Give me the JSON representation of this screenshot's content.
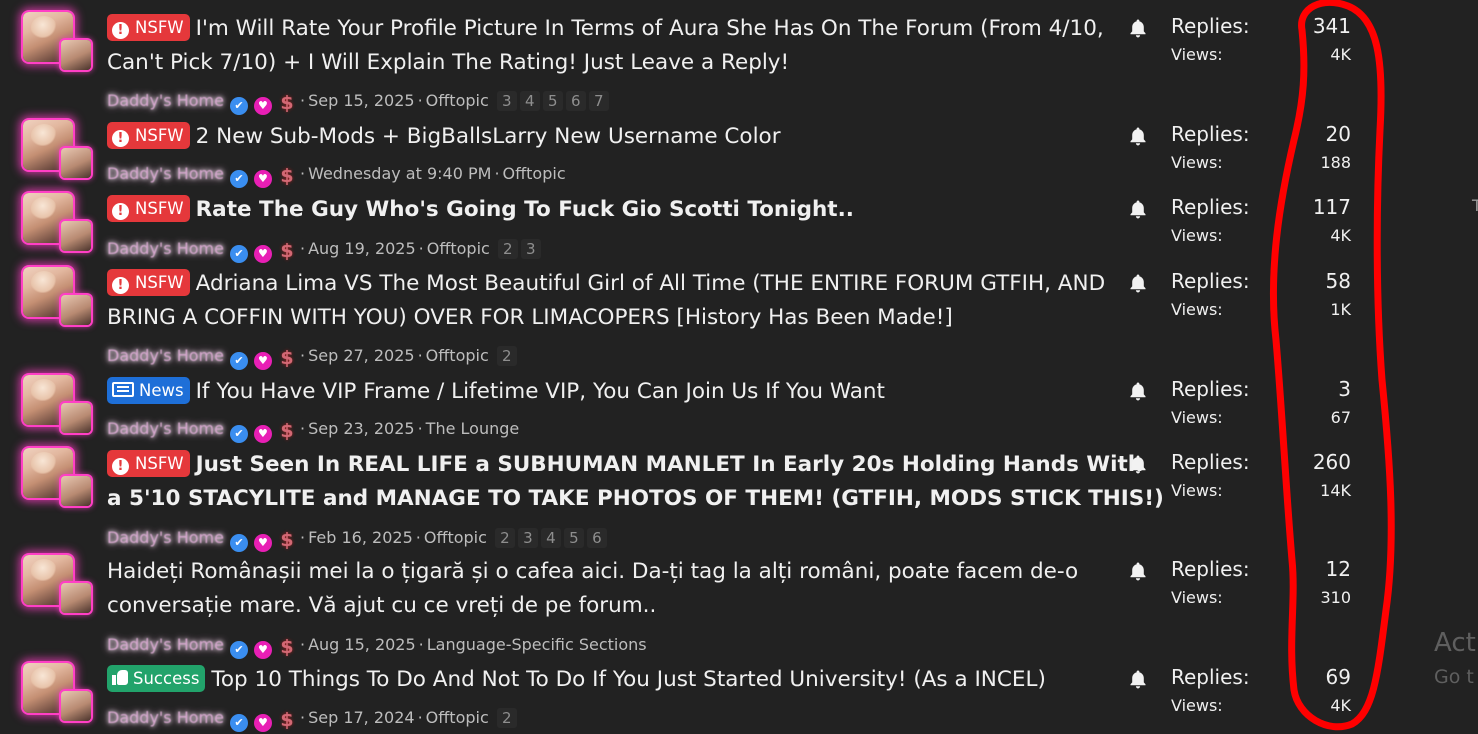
{
  "threads": [
    {
      "prefix": {
        "label": "NSFW",
        "type": "nsfw"
      },
      "title_lines": [
        "I'm Will Rate Your Profile Picture In Terms of Aura She Has On The Forum (From 4/10,",
        "Can't Pick 7/10) + I Will Explain The Rating! Just Leave a Reply!"
      ],
      "bold": false,
      "author": "Daddy's Home",
      "date": "Sep 15, 2025",
      "forum": "Offtopic",
      "pages": [
        "3",
        "4",
        "5",
        "6",
        "7"
      ],
      "replies_label": "Replies:",
      "replies": "341",
      "views_label": "Views:",
      "views": "4K"
    },
    {
      "prefix": {
        "label": "NSFW",
        "type": "nsfw"
      },
      "title_lines": [
        "2 New Sub-Mods + BigBallsLarry New Username Color"
      ],
      "bold": false,
      "author": "Daddy's Home",
      "date": "Wednesday at 9:40 PM",
      "forum": "Offtopic",
      "pages": [],
      "replies_label": "Replies:",
      "replies": "20",
      "views_label": "Views:",
      "views": "188"
    },
    {
      "prefix": {
        "label": "NSFW",
        "type": "nsfw"
      },
      "title_lines": [
        "Rate The Guy Who's Going To Fuck Gio Scotti Tonight.."
      ],
      "bold": true,
      "author": "Daddy's Home",
      "date": "Aug 19, 2025",
      "forum": "Offtopic",
      "pages": [
        "2",
        "3"
      ],
      "replies_label": "Replies:",
      "replies": "117",
      "views_label": "Views:",
      "views": "4K"
    },
    {
      "prefix": {
        "label": "NSFW",
        "type": "nsfw"
      },
      "title_lines": [
        "Adriana Lima VS The Most Beautiful Girl of All Time (THE ENTIRE FORUM GTFIH, AND",
        "BRING A COFFIN WITH YOU) OVER FOR LIMACOPERS [History Has Been Made!]"
      ],
      "bold": false,
      "author": "Daddy's Home",
      "date": "Sep 27, 2025",
      "forum": "Offtopic",
      "pages": [
        "2"
      ],
      "replies_label": "Replies:",
      "replies": "58",
      "views_label": "Views:",
      "views": "1K"
    },
    {
      "prefix": {
        "label": "News",
        "type": "news"
      },
      "title_lines": [
        "If You Have VIP Frame / Lifetime VIP, You Can Join Us If You Want"
      ],
      "bold": false,
      "author": "Daddy's Home",
      "date": "Sep 23, 2025",
      "forum": "The Lounge",
      "pages": [],
      "replies_label": "Replies:",
      "replies": "3",
      "views_label": "Views:",
      "views": "67"
    },
    {
      "prefix": {
        "label": "NSFW",
        "type": "nsfw"
      },
      "title_lines": [
        "Just Seen In REAL LIFE a SUBHUMAN MANLET In Early 20s Holding Hands With",
        "a 5'10 STACYLITE and MANAGE TO TAKE PHOTOS OF THEM! (GTFIH, MODS STICK THIS!)"
      ],
      "bold": true,
      "author": "Daddy's Home",
      "date": "Feb 16, 2025",
      "forum": "Offtopic",
      "pages": [
        "2",
        "3",
        "4",
        "5",
        "6"
      ],
      "replies_label": "Replies:",
      "replies": "260",
      "views_label": "Views:",
      "views": "14K"
    },
    {
      "prefix": null,
      "title_lines": [
        "Haideți Românașii mei la o țigară și o cafea aici. Da-ți tag la alți români, poate facem de-o",
        "conversație mare. Vă ajut cu ce vreți de pe forum.."
      ],
      "bold": false,
      "author": "Daddy's Home",
      "date": "Aug 15, 2025",
      "forum": "Language-Specific Sections",
      "pages": [],
      "replies_label": "Replies:",
      "replies": "12",
      "views_label": "Views:",
      "views": "310"
    },
    {
      "prefix": {
        "label": "Success",
        "type": "success"
      },
      "title_lines": [
        "Top 10 Things To Do And Not To Do If You Just Started University! (As a INCEL)"
      ],
      "bold": false,
      "author": "Daddy's Home",
      "date": "Sep 17, 2024",
      "forum": "Offtopic",
      "pages": [
        "2"
      ],
      "replies_label": "Replies:",
      "replies": "69",
      "views_label": "Views:",
      "views": "4K"
    }
  ],
  "icons": {
    "prefix_nsfw": "exclamation-circle-icon",
    "prefix_news": "newspaper-icon",
    "prefix_success": "thumbs-up-icon",
    "watch": "bell-icon",
    "badges": [
      "verified-check-icon",
      "heart-badge-icon",
      "dollar-badge-icon"
    ]
  },
  "colors": {
    "background": "#222222",
    "nsfw": "#e5383b",
    "news": "#1e6fd8",
    "success": "#22a36b",
    "avatar_glow": "#ff3fc6",
    "annotation": "#ff0000"
  },
  "overlay": {
    "activate_title": "Act",
    "activate_sub": "Go t",
    "edge_char": "T"
  }
}
